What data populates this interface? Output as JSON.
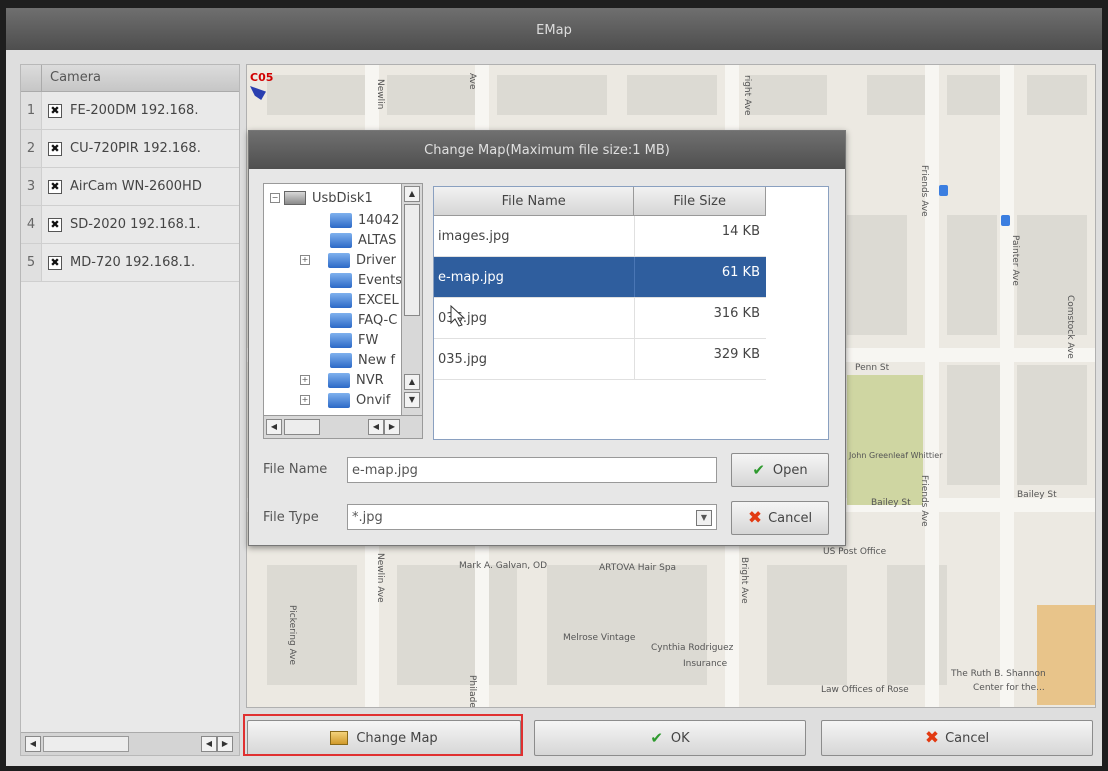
{
  "window": {
    "title": "EMap"
  },
  "camera_list": {
    "header": "Camera",
    "items": [
      {
        "num": "1",
        "label": "FE-200DM 192.168."
      },
      {
        "num": "2",
        "label": "CU-720PIR 192.168."
      },
      {
        "num": "3",
        "label": "AirCam WN-2600HD"
      },
      {
        "num": "4",
        "label": "SD-2020 192.168.1."
      },
      {
        "num": "5",
        "label": "MD-720 192.168.1."
      }
    ]
  },
  "map": {
    "camera_marker": "C05",
    "labels": {
      "newlin_ave_top": "Newlin",
      "ave_top": "Ave",
      "right_ave_top": "right Ave",
      "friends_ave": "Friends Ave",
      "painter_ave": "Painter Ave",
      "comstock_ave": "Comstock Ave",
      "bright_ave_bottom": "Bright Ave",
      "newlin_ave_bottom": "Newlin Ave",
      "pickering_ave": "Pickering Ave",
      "philadelphia_ave": "Philadelphia Ave",
      "penn_st": "Penn St",
      "bailey_st": "Bailey St",
      "bailey_st_right": "Bailey St",
      "friends_ave_lower": "Friends Ave",
      "park": "John Greenleaf Whittier",
      "post_office": "US Post Office",
      "mark_galvan": "Mark A. Galvan, OD",
      "hair_spa": "ARTOVA Hair Spa",
      "melrose": "Melrose Vintage",
      "cynthia": "Cynthia Rodriguez",
      "insurance": "Insurance",
      "law_offices": "Law Offices of Rose",
      "ruth_shannon": "The Ruth B. Shannon",
      "center": "Center for the..."
    }
  },
  "dialog": {
    "title": "Change Map(Maximum file size:1 MB)",
    "tree": [
      {
        "label": "UsbDisk1"
      },
      {
        "label": "14042"
      },
      {
        "label": "ALTAS"
      },
      {
        "label": "Driver"
      },
      {
        "label": "Events"
      },
      {
        "label": "EXCEL"
      },
      {
        "label": "FAQ-C"
      },
      {
        "label": "FW"
      },
      {
        "label": "New f"
      },
      {
        "label": "NVR"
      },
      {
        "label": "Onvif"
      }
    ],
    "file_table": {
      "headers": [
        "File Name",
        "File Size"
      ],
      "rows": [
        {
          "name": "images.jpg",
          "size": "14 KB"
        },
        {
          "name": "e-map.jpg",
          "size": "61 KB"
        },
        {
          "name": "036.jpg",
          "size": "316 KB"
        },
        {
          "name": "035.jpg",
          "size": "329 KB"
        }
      ]
    },
    "file_name_label": "File Name",
    "file_name_value": "e-map.jpg",
    "file_type_label": "File Type",
    "file_type_value": "*.jpg",
    "open_label": "Open",
    "cancel_label": "Cancel"
  },
  "footer": {
    "change_map_label": "Change Map",
    "ok_label": "OK",
    "cancel_label": "Cancel"
  }
}
